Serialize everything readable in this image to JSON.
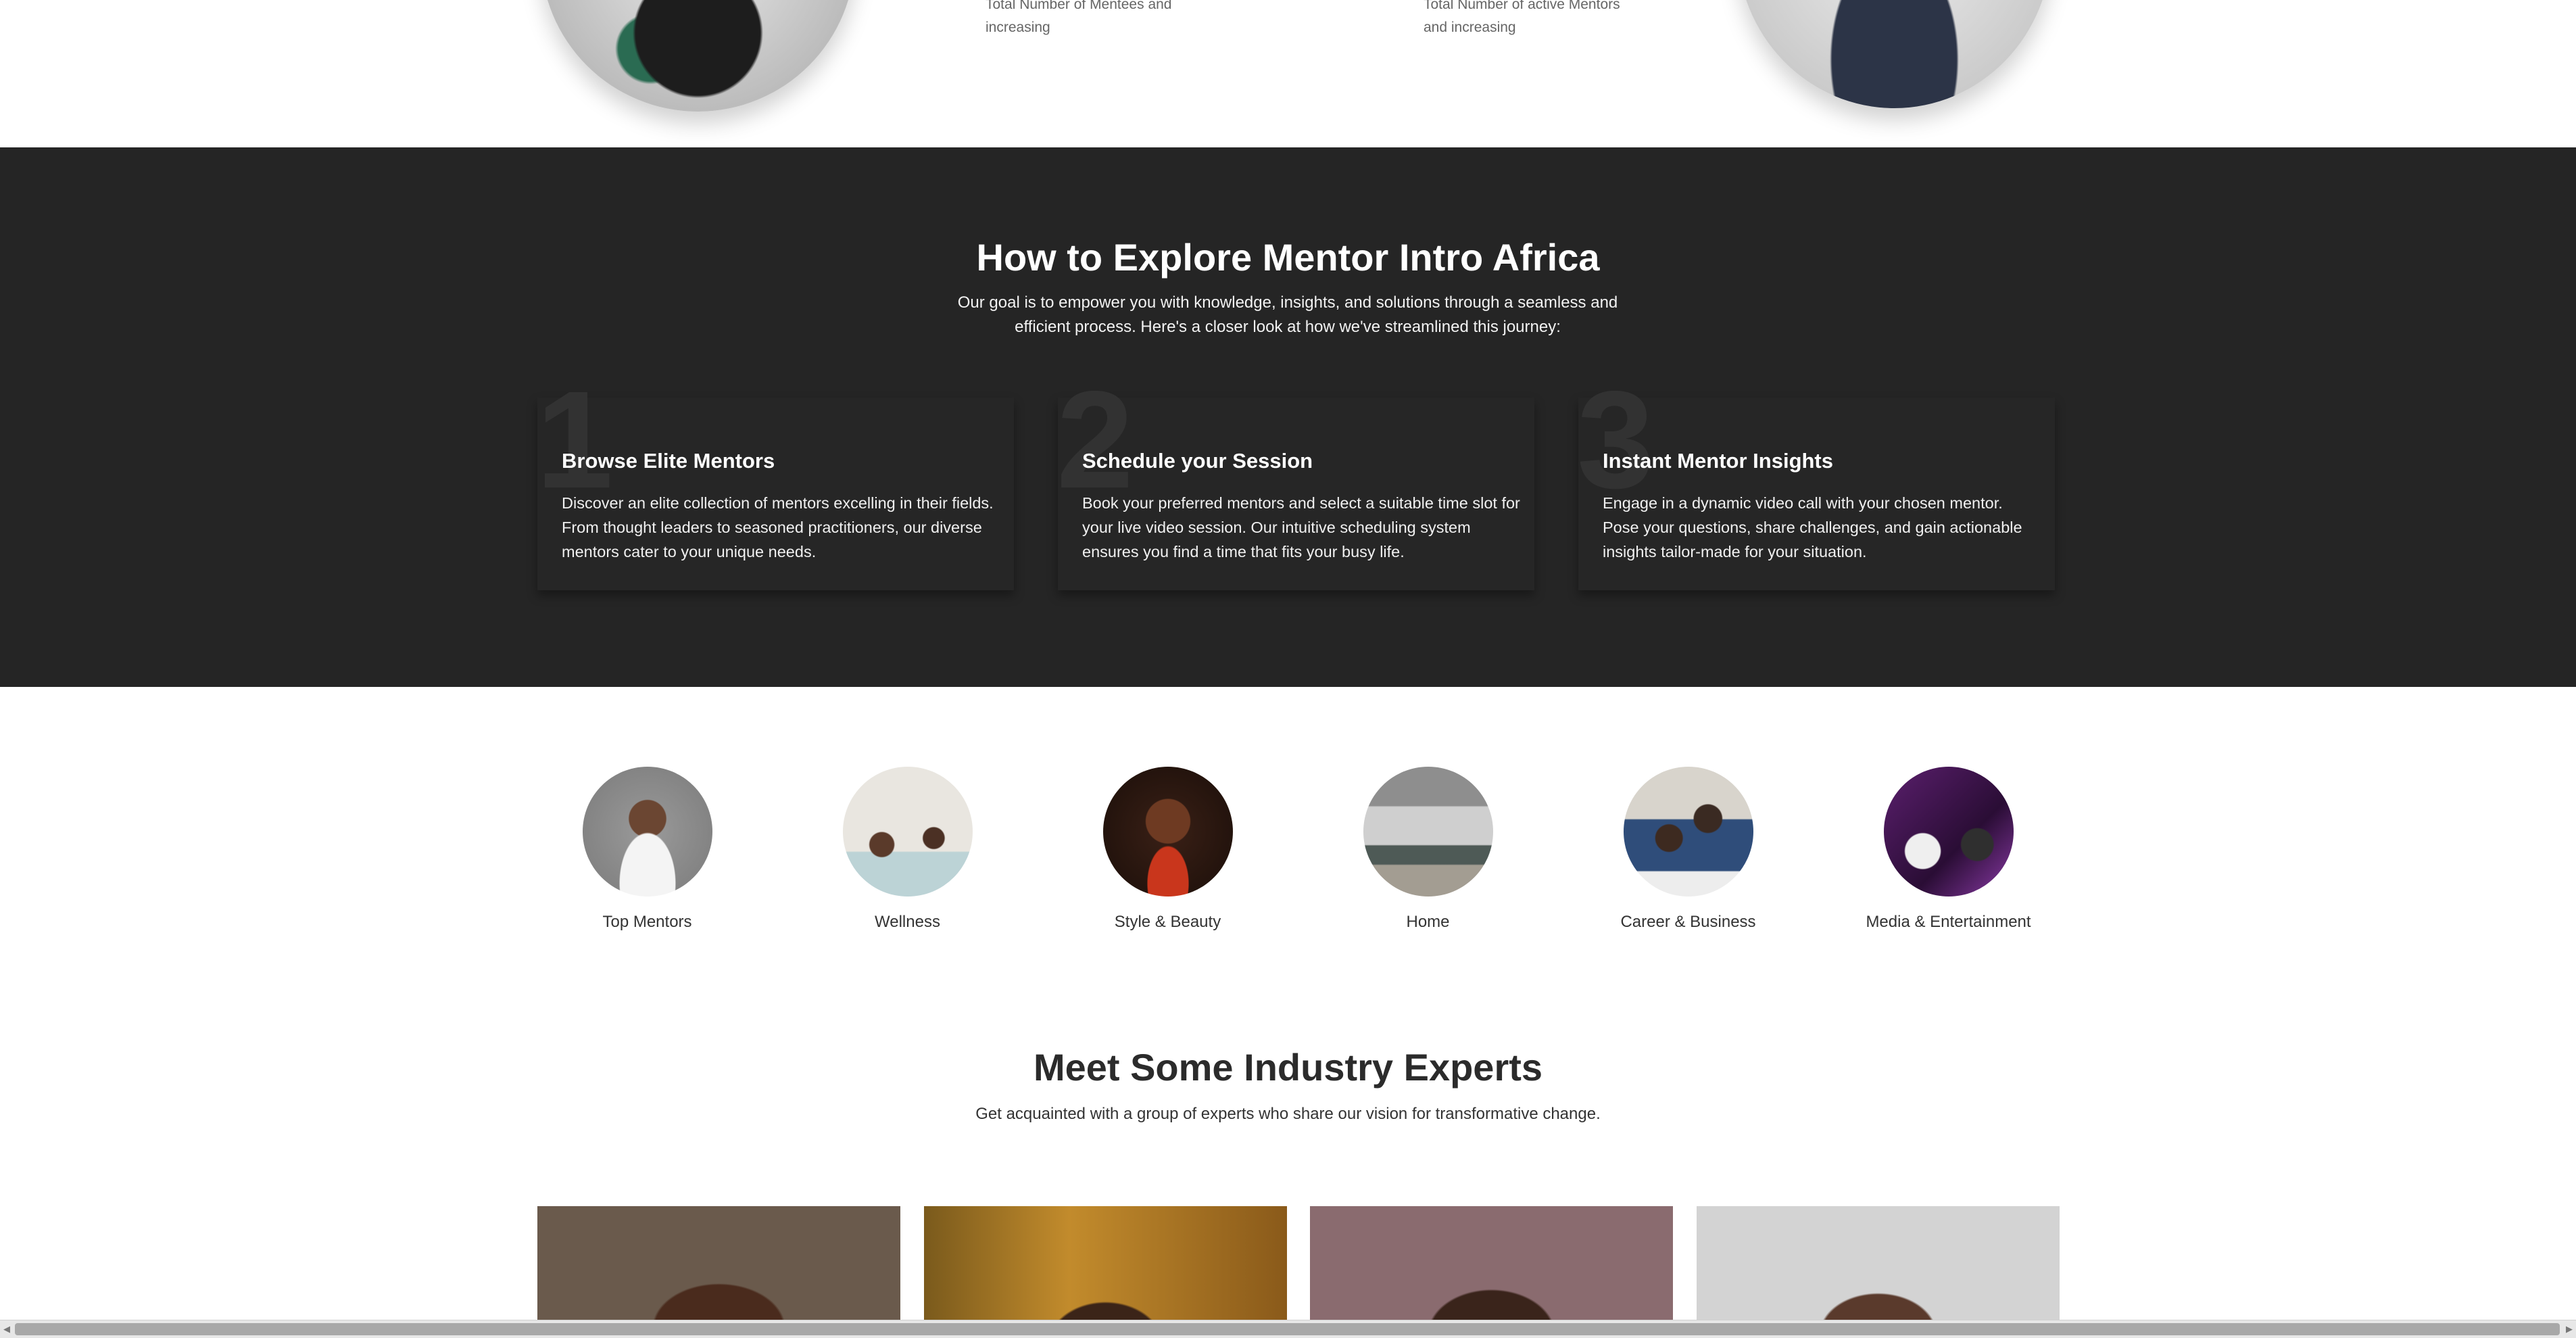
{
  "stats": {
    "mentees_caption": "Total Number of Mentees and increasing",
    "mentors_caption": "Total Number of active Mentors and increasing"
  },
  "howto": {
    "title": "How to Explore Mentor Intro Africa",
    "intro": "Our goal is to empower you with knowledge, insights, and solutions through a seamless and efficient process. Here's a closer look at how we've streamlined this journey:",
    "steps": [
      {
        "number": "1",
        "title": "Browse Elite Mentors",
        "text": "Discover an elite collection of mentors excelling in their fields. From thought leaders to seasoned practitioners, our diverse mentors cater to your unique needs."
      },
      {
        "number": "2",
        "title": "Schedule your Session",
        "text": "Book your preferred mentors and select a suitable time slot for your live video session. Our intuitive scheduling system ensures you find a time that fits your busy life."
      },
      {
        "number": "3",
        "title": "Instant Mentor Insights",
        "text": "Engage in a dynamic video call with your chosen mentor. Pose your questions, share challenges, and gain actionable insights tailor-made for your situation."
      }
    ]
  },
  "categories": [
    {
      "label": "Top Mentors"
    },
    {
      "label": "Wellness"
    },
    {
      "label": "Style & Beauty"
    },
    {
      "label": "Home"
    },
    {
      "label": "Career & Business"
    },
    {
      "label": "Media & Entertainment"
    }
  ],
  "experts": {
    "title": "Meet Some Industry Experts",
    "subtitle": "Get acquainted with a group of experts who share our vision for transformative change."
  },
  "scrollbar": {
    "left_arrow": "◀",
    "right_arrow": "▶"
  }
}
